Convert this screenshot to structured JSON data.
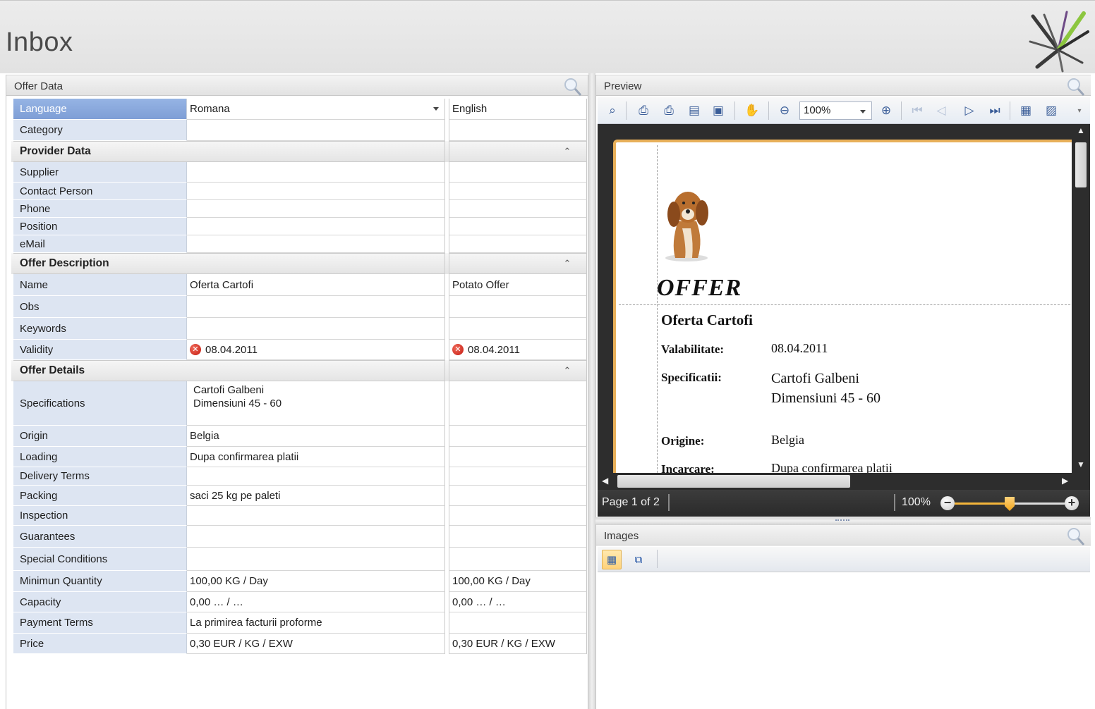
{
  "app": {
    "title": "Inbox"
  },
  "offer_panel": {
    "title": "Offer Data",
    "language_row": {
      "label": "Language",
      "value": "Romana",
      "value2": "English"
    },
    "category_row": {
      "label": "Category",
      "value": "",
      "value2": ""
    },
    "sections": {
      "provider": {
        "title": "Provider Data"
      },
      "description": {
        "title": "Offer Description"
      },
      "details": {
        "title": "Offer Details"
      }
    },
    "provider_rows": [
      {
        "label": "Supplier",
        "value": "",
        "value2": ""
      },
      {
        "label": "Contact Person",
        "value": "",
        "value2": ""
      },
      {
        "label": "Phone",
        "value": "",
        "value2": ""
      },
      {
        "label": "Position",
        "value": "",
        "value2": ""
      },
      {
        "label": "eMail",
        "value": "",
        "value2": ""
      }
    ],
    "description_rows": [
      {
        "label": "Name",
        "value": "Oferta Cartofi",
        "value2": "Potato Offer"
      },
      {
        "label": "Obs",
        "value": "",
        "value2": ""
      },
      {
        "label": "Keywords",
        "value": "",
        "value2": ""
      },
      {
        "label": "Validity",
        "value": "08.04.2011",
        "value2": "08.04.2011"
      }
    ],
    "details_rows": [
      {
        "label": "Specifications",
        "value_line1": "Cartofi Galbeni",
        "value_line2": "Dimensiuni 45 - 60",
        "value2": ""
      },
      {
        "label": "Origin",
        "value": "Belgia",
        "value2": ""
      },
      {
        "label": "Loading",
        "value": "Dupa confirmarea platii",
        "value2": ""
      },
      {
        "label": "Delivery Terms",
        "value": "",
        "value2": ""
      },
      {
        "label": "Packing",
        "value": "saci 25 kg pe paleti",
        "value2": ""
      },
      {
        "label": "Inspection",
        "value": "",
        "value2": ""
      },
      {
        "label": "Guarantees",
        "value": "",
        "value2": ""
      },
      {
        "label": "Special Conditions",
        "value": "",
        "value2": ""
      },
      {
        "label": "Minimun Quantity",
        "value": "100,00 KG / Day",
        "value2": "100,00 KG / Day"
      },
      {
        "label": "Capacity",
        "value": "0,00 … / …",
        "value2": "0,00 … / …"
      },
      {
        "label": "Payment Terms",
        "value": "La primirea facturii proforme",
        "value2": ""
      },
      {
        "label": "Price",
        "value": "0,30 EUR / KG / EXW",
        "value2": "0,30 EUR / KG / EXW"
      }
    ]
  },
  "preview": {
    "title": "Preview",
    "zoom": "100%",
    "document": {
      "heading": "OFFER",
      "name": "Oferta Cartofi",
      "fields": [
        {
          "key": "Valabilitate:",
          "value": "08.04.2011"
        },
        {
          "key": "Specificatii:",
          "value_line1": "Cartofi  Galbeni",
          "value_line2": "Dimensiuni   45 - 60"
        },
        {
          "key": "Origine:",
          "value": "Belgia"
        },
        {
          "key": "Incarcare:",
          "value": "Dupa confirmarea platii"
        }
      ]
    },
    "status": {
      "page": "Page 1 of 2",
      "zoom": "100%",
      "zoom_fraction": 0.5
    }
  },
  "images_panel": {
    "title": "Images"
  },
  "colors": {
    "selected_label": "#7e9ed6",
    "label_bg": "#dde5f2",
    "page_border": "#e8b05a",
    "error": "#c41a10"
  }
}
